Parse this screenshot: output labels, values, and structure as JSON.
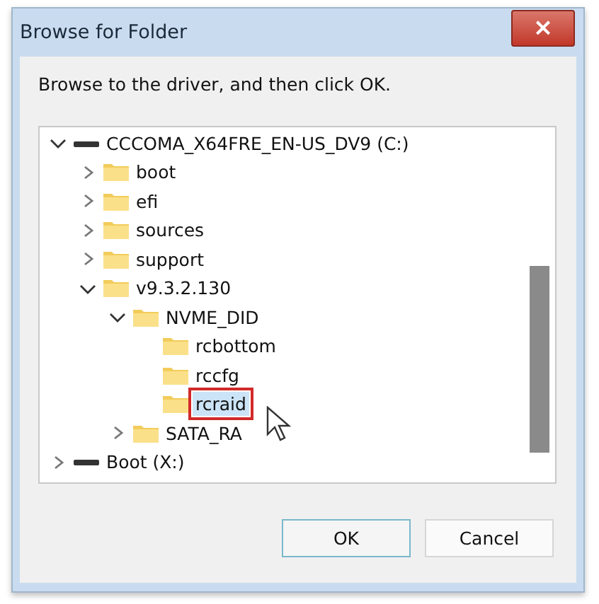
{
  "window": {
    "title": "Browse for Folder",
    "close_label": "×"
  },
  "instruction": "Browse to the driver, and then click OK.",
  "tree": [
    {
      "label": "CCCOMA_X64FRE_EN-US_DV9 (C:)",
      "kind": "drive",
      "expanded": true,
      "selected": false,
      "children": [
        {
          "label": "boot",
          "kind": "folder",
          "expanded": false,
          "selected": false
        },
        {
          "label": "efi",
          "kind": "folder",
          "expanded": false,
          "selected": false
        },
        {
          "label": "sources",
          "kind": "folder",
          "expanded": false,
          "selected": false
        },
        {
          "label": "support",
          "kind": "folder",
          "expanded": false,
          "selected": false
        },
        {
          "label": "v9.3.2.130",
          "kind": "folder",
          "expanded": true,
          "selected": false,
          "children": [
            {
              "label": "NVME_DID",
              "kind": "folder",
              "expanded": true,
              "selected": false,
              "children": [
                {
                  "label": "rcbottom",
                  "kind": "folder",
                  "selected": false
                },
                {
                  "label": "rccfg",
                  "kind": "folder",
                  "selected": false
                },
                {
                  "label": "rcraid",
                  "kind": "folder",
                  "selected": true
                }
              ]
            },
            {
              "label": "SATA_RA",
              "kind": "folder",
              "expanded": false,
              "selected": false
            }
          ]
        }
      ]
    },
    {
      "label": "Boot (X:)",
      "kind": "drive",
      "expanded": false,
      "selected": false
    }
  ],
  "buttons": [
    {
      "label": "OK",
      "kind": "default"
    },
    {
      "label": "Cancel",
      "kind": "normal"
    }
  ]
}
